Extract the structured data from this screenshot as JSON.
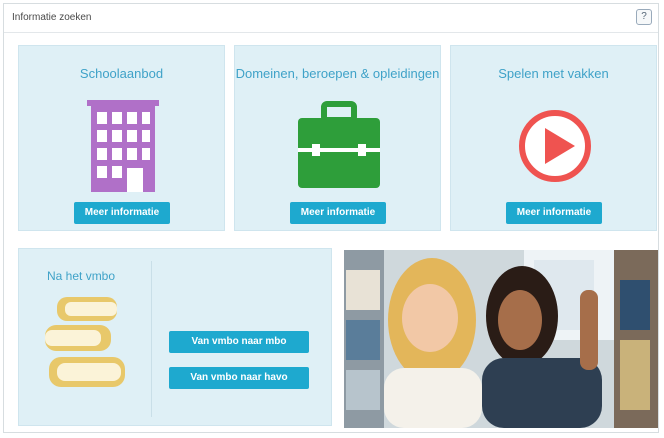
{
  "window": {
    "title": "Informatie zoeken",
    "help_label": "?"
  },
  "tiles": [
    {
      "title": "Schoolaanbod",
      "button": "Meer informatie",
      "icon": "building-icon"
    },
    {
      "title": "Domeinen, beroepen & opleidingen",
      "button": "Meer informatie",
      "icon": "briefcase-icon"
    },
    {
      "title": "Spelen met vakken",
      "button": "Meer informatie",
      "icon": "play-icon"
    }
  ],
  "vmbo": {
    "title": "Na het vmbo",
    "icon": "books-icon",
    "buttons": [
      "Van vmbo naar mbo",
      "Van vmbo naar havo"
    ]
  },
  "photo": {
    "subject": "two-students-in-library-photo"
  },
  "colors": {
    "tile_bg": "#dff0f6",
    "accent": "#3fa2c8",
    "button": "#1ea9cf",
    "building": "#b070c8",
    "briefcase": "#2e9e3a",
    "play": "#ef5350",
    "books": "#e8c86a"
  }
}
